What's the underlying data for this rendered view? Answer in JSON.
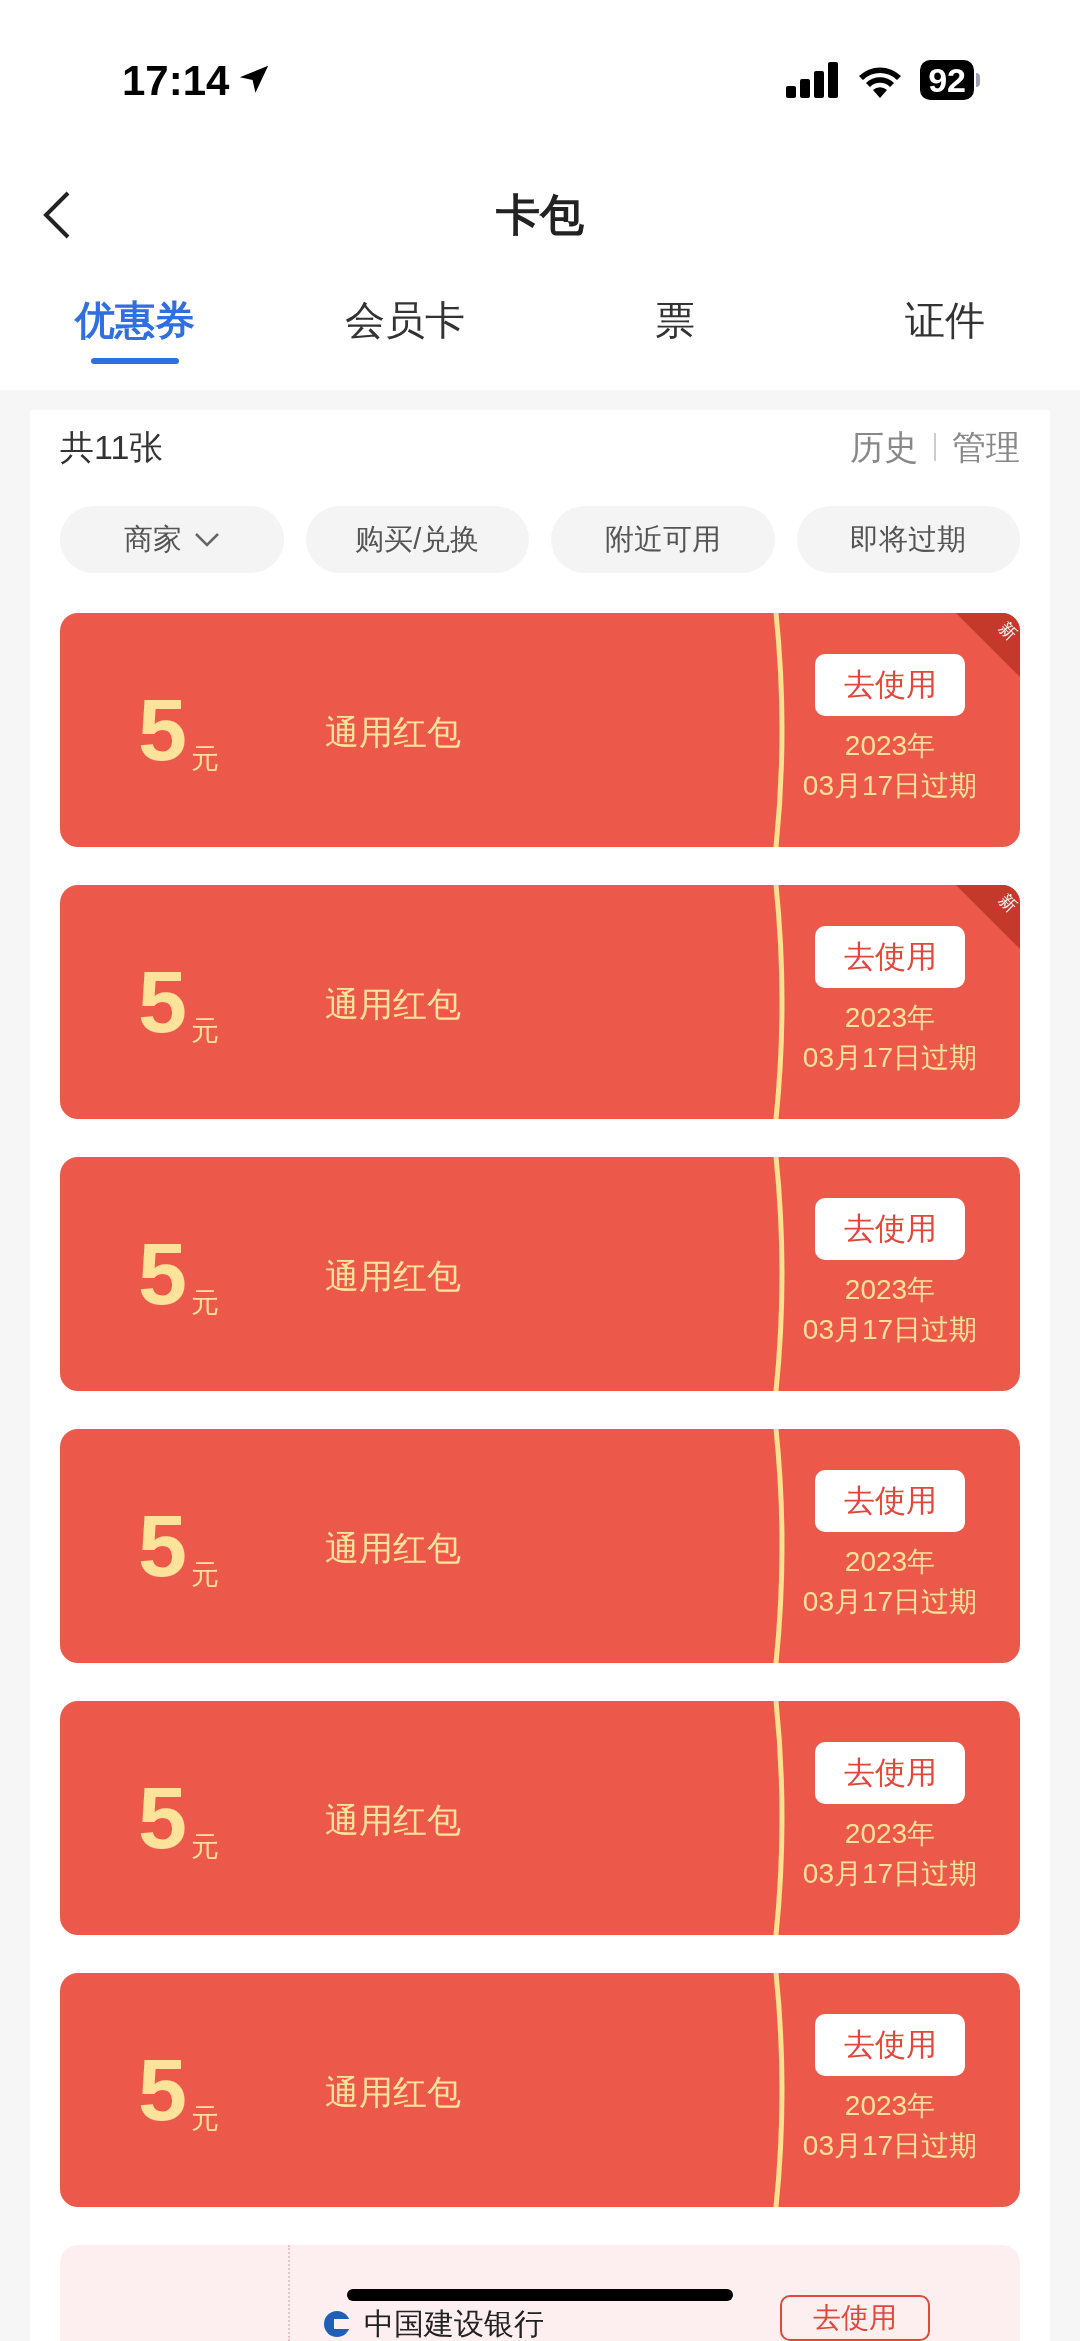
{
  "status_bar": {
    "time": "17:14",
    "battery": "92"
  },
  "header": {
    "title": "卡包"
  },
  "tabs": [
    {
      "label": "优惠券",
      "selected": true
    },
    {
      "label": "会员卡",
      "selected": false
    },
    {
      "label": "票",
      "selected": false
    },
    {
      "label": "证件",
      "selected": false
    }
  ],
  "summary": {
    "count": "共11张",
    "links": [
      "历史",
      "管理"
    ]
  },
  "filters": [
    {
      "label": "商家",
      "dropdown": true
    },
    {
      "label": "购买/兑换",
      "dropdown": false
    },
    {
      "label": "附近可用",
      "dropdown": false
    },
    {
      "label": "即将过期",
      "dropdown": false
    }
  ],
  "coupons": [
    {
      "kind": "red",
      "amount": "5",
      "unit": "元",
      "name": "通用红包",
      "button": "去使用",
      "expiry_year": "2023年",
      "expiry_date": "03月17日过期",
      "new_badge": "新"
    },
    {
      "kind": "red",
      "amount": "5",
      "unit": "元",
      "name": "通用红包",
      "button": "去使用",
      "expiry_year": "2023年",
      "expiry_date": "03月17日过期",
      "new_badge": "新"
    },
    {
      "kind": "red",
      "amount": "5",
      "unit": "元",
      "name": "通用红包",
      "button": "去使用",
      "expiry_year": "2023年",
      "expiry_date": "03月17日过期"
    },
    {
      "kind": "red",
      "amount": "5",
      "unit": "元",
      "name": "通用红包",
      "button": "去使用",
      "expiry_year": "2023年",
      "expiry_date": "03月17日过期"
    },
    {
      "kind": "red",
      "amount": "5",
      "unit": "元",
      "name": "通用红包",
      "button": "去使用",
      "expiry_year": "2023年",
      "expiry_date": "03月17日过期"
    },
    {
      "kind": "red",
      "amount": "5",
      "unit": "元",
      "name": "通用红包",
      "button": "去使用",
      "expiry_year": "2023年",
      "expiry_date": "03月17日过期"
    },
    {
      "kind": "bank",
      "name": "中国建设银行",
      "button": "去使用"
    }
  ]
}
